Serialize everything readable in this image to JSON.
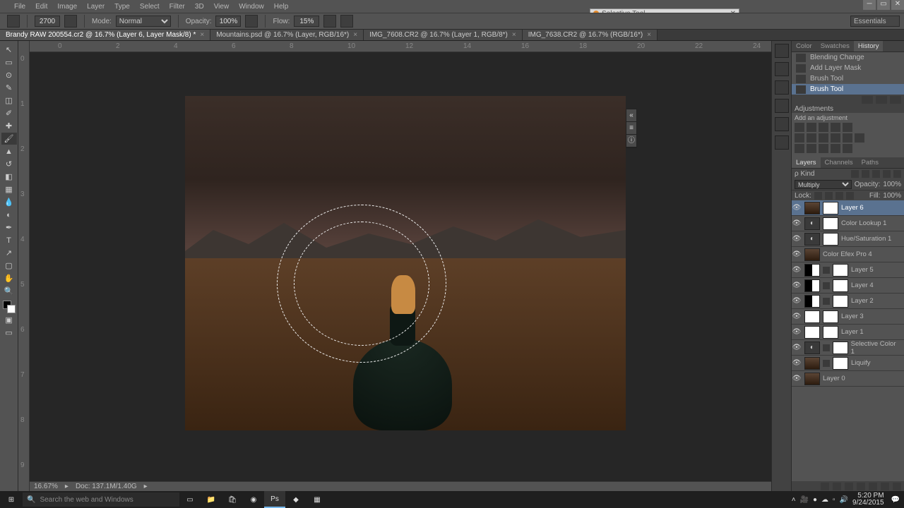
{
  "menubar": [
    "File",
    "Edit",
    "Image",
    "Layer",
    "Type",
    "Select",
    "Filter",
    "3D",
    "View",
    "Window",
    "Help"
  ],
  "floating_tool": "Selective Tool",
  "options": {
    "size": "2700",
    "mode_label": "Mode:",
    "mode": "Normal",
    "opacity_label": "Opacity:",
    "opacity": "100%",
    "flow_label": "Flow:",
    "flow": "15%",
    "workspace": "Essentials"
  },
  "tabs": [
    {
      "label": "Brandy RAW 200554.cr2 @ 16.7% (Layer 6, Layer Mask/8) *",
      "active": true
    },
    {
      "label": "Mountains.psd @ 16.7% (Layer, RGB/16*)",
      "active": false
    },
    {
      "label": "IMG_7608.CR2 @ 16.7% (Layer 1, RGB/8*)",
      "active": false
    },
    {
      "label": "IMG_7638.CR2 @ 16.7% (RGB/16*)",
      "active": false
    }
  ],
  "ruler_h": [
    "0",
    "2",
    "4",
    "6",
    "8",
    "10",
    "12",
    "14",
    "16",
    "18",
    "20",
    "22",
    "24"
  ],
  "ruler_v": [
    "0",
    "1",
    "2",
    "3",
    "4",
    "5",
    "6",
    "7",
    "8",
    "9"
  ],
  "status": {
    "zoom": "16.67%",
    "doc": "Doc: 137.1M/1.40G"
  },
  "panels": {
    "history_tabs": [
      "Color",
      "Swatches",
      "History"
    ],
    "history": [
      {
        "label": "Blending Change",
        "sel": false
      },
      {
        "label": "Add Layer Mask",
        "sel": false
      },
      {
        "label": "Brush Tool",
        "sel": false
      },
      {
        "label": "Brush Tool",
        "sel": true
      }
    ],
    "adjustments_title": "Adjustments",
    "adjustments_hint": "Add an adjustment",
    "layers_tabs": [
      "Layers",
      "Channels",
      "Paths"
    ],
    "kind_label": "ρ Kind",
    "blend": "Multiply",
    "opacity_label": "Opacity:",
    "opacity": "100%",
    "lock_label": "Lock:",
    "fill_label": "Fill:",
    "fill": "100%",
    "layers": [
      {
        "name": "Layer 6",
        "sel": true,
        "mask": true,
        "thumb": "img"
      },
      {
        "name": "Color Lookup 1",
        "mask": true,
        "thumb": "adj"
      },
      {
        "name": "Hue/Saturation 1",
        "mask": true,
        "thumb": "adj"
      },
      {
        "name": "Color Efex Pro 4",
        "thumb": "img"
      },
      {
        "name": "Layer 5",
        "mask": true,
        "thumb": "bw",
        "link": true
      },
      {
        "name": "Layer 4",
        "mask": true,
        "thumb": "bw",
        "link": true
      },
      {
        "name": "Layer 2",
        "mask": true,
        "thumb": "bw",
        "link": true
      },
      {
        "name": "Layer 3",
        "mask": true,
        "thumb": "wht"
      },
      {
        "name": "Layer 1",
        "mask": true,
        "thumb": "wht"
      },
      {
        "name": "Selective Color 1",
        "mask": true,
        "thumb": "adj",
        "link": true
      },
      {
        "name": "Liquify",
        "mask": true,
        "thumb": "img",
        "link": true
      },
      {
        "name": "Layer 0",
        "thumb": "img"
      }
    ]
  },
  "taskbar": {
    "search_placeholder": "Search the web and Windows",
    "time": "5:20 PM",
    "date": "9/24/2015"
  }
}
